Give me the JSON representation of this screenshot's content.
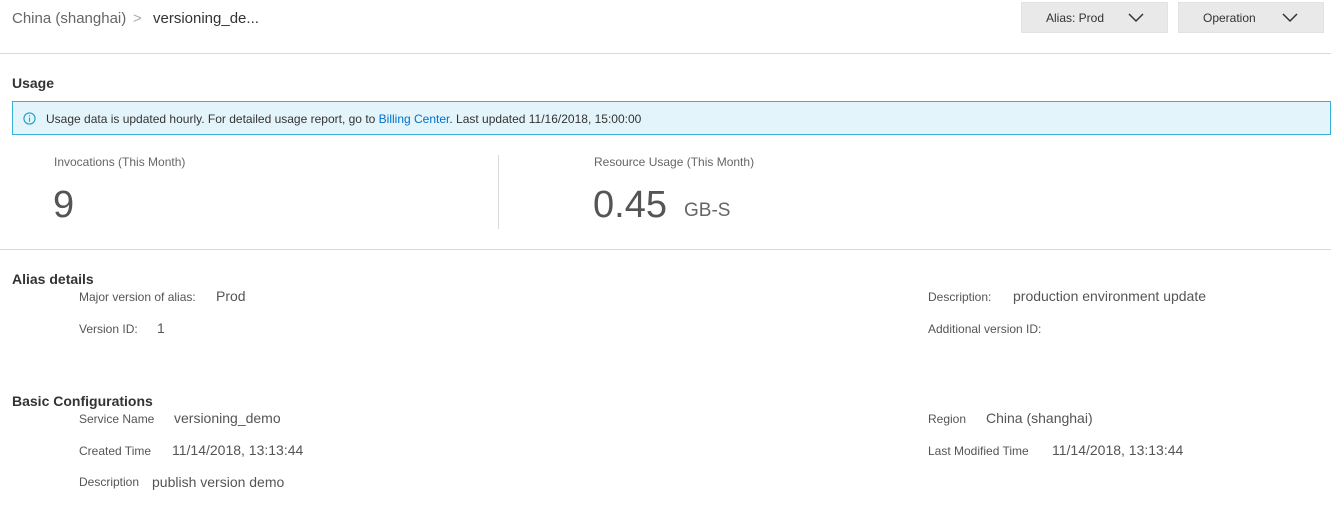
{
  "breadcrumb": {
    "root": "China (shanghai)",
    "separator": ">",
    "current": "versioning_de..."
  },
  "toolbar": {
    "alias_button": "Alias: Prod",
    "operation_button": "Operation"
  },
  "usage": {
    "title": "Usage",
    "banner": {
      "prefix": "Usage data is updated hourly. For detailed usage report, go to ",
      "link": "Billing Center",
      "suffix": ". Last updated  11/16/2018, 15:00:00"
    },
    "invocations_label": "Invocations (This Month)",
    "invocations_value": "9",
    "resource_label": "Resource Usage (This Month)",
    "resource_value": "0.45",
    "resource_unit": "GB-S"
  },
  "alias_details": {
    "title": "Alias details",
    "major_version_label": "Major version of alias:",
    "major_version_value": "Prod",
    "version_id_label": "Version ID:",
    "version_id_value": "1",
    "description_label": "Description:",
    "description_value": "production environment update",
    "additional_version_label": "Additional version ID:"
  },
  "basic_config": {
    "title": "Basic Configurations",
    "service_name_label": "Service Name",
    "service_name_value": "versioning_demo",
    "created_time_label": "Created Time",
    "created_time_value": "11/14/2018, 13:13:44",
    "description_label": "Description",
    "description_value": "publish version demo",
    "region_label": "Region",
    "region_value": "China (shanghai)",
    "last_modified_label": "Last Modified Time",
    "last_modified_value": "11/14/2018, 13:13:44"
  },
  "colors": {
    "banner_bg": "#e3f5fb",
    "banner_border": "#3ab0d8",
    "link": "#0070cc"
  },
  "icons": [
    "chevron-down-icon",
    "info-icon"
  ]
}
